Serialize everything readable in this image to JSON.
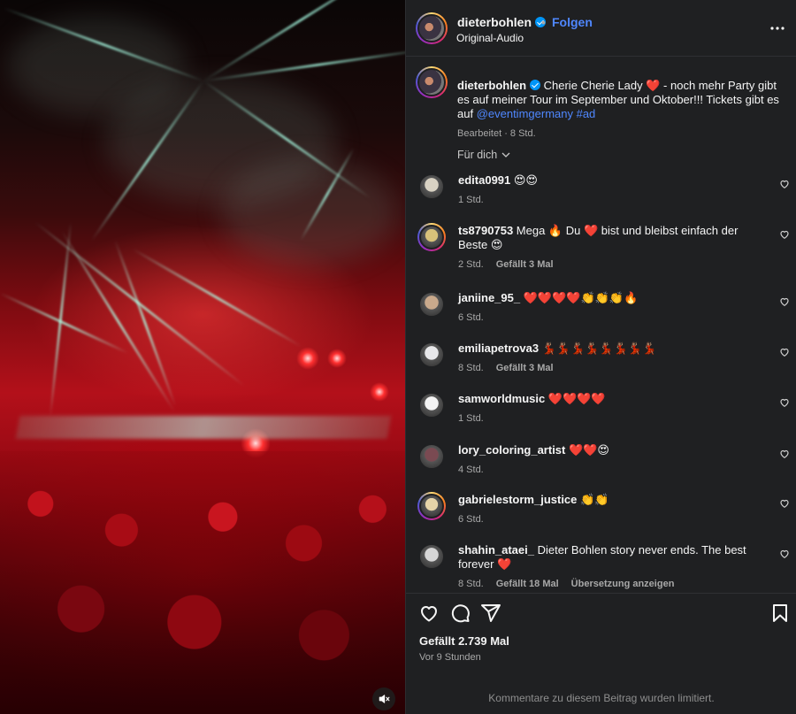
{
  "post": {
    "author": "dieterbohlen",
    "follow_label": "Folgen",
    "separator": "•",
    "audio": "Original-Audio",
    "caption_body": " Cherie Cherie Lady ❤️ - noch mehr Party gibt es auf meiner Tour im September und Oktober!!! Tickets gibt es auf ",
    "caption_mention": "@eventimgermany",
    "caption_hashtag": " #ad",
    "caption_meta": "Bearbeitet · 8 Std.",
    "filter_label": "Für dich"
  },
  "comments": [
    {
      "user": "edita0991",
      "text": " 😍😍",
      "time": "1 Std.",
      "likes": "",
      "extra": "",
      "avatar_color": "#d9d2c3",
      "ring": false
    },
    {
      "user": "ts8790753",
      "text": " Mega 🔥 Du ❤️ bist und bleibst einfach der Beste 😍",
      "time": "2 Std.",
      "likes": "Gefällt 3 Mal",
      "extra": "",
      "avatar_color": "#d8c27a",
      "ring": true
    },
    {
      "user": "janiine_95_",
      "text": " ❤️❤️❤️❤️👏👏👏🔥",
      "time": "6 Std.",
      "likes": "",
      "extra": "",
      "avatar_color": "#c9a98c",
      "ring": false
    },
    {
      "user": "emiliapetrova3",
      "text": " 💃🏽💃🏽💃🏽💃🏽💃🏽💃🏽💃🏽💃🏽",
      "time": "8 Std.",
      "likes": "Gefällt 3 Mal",
      "extra": "",
      "avatar_color": "#e8e8ea",
      "ring": false
    },
    {
      "user": "samworldmusic",
      "text": " ❤️❤️❤️❤️",
      "time": "1 Std.",
      "likes": "",
      "extra": "",
      "avatar_color": "#f4f4f4",
      "ring": false
    },
    {
      "user": "lory_coloring_artist",
      "text": " ❤️❤️😍",
      "time": "4 Std.",
      "likes": "",
      "extra": "",
      "avatar_color": "#7a4a52",
      "ring": false
    },
    {
      "user": "gabrielestorm_justice",
      "text": " 👏👏",
      "time": "6 Std.",
      "likes": "",
      "extra": "",
      "avatar_color": "#e6d4a8",
      "ring": true
    },
    {
      "user": "shahin_ataei_",
      "text": " Dieter Bohlen story never ends. The best forever ❤️",
      "time": "8 Std.",
      "likes": "Gefällt 18 Mal",
      "extra": "Übersetzung anzeigen",
      "avatar_color": "#d6d6d6",
      "ring": false
    }
  ],
  "footer": {
    "likes": "Gefällt 2.739 Mal",
    "ago": "Vor 9 Stunden",
    "limited": "Kommentare zu diesem Beitrag wurden limitiert."
  },
  "colors": {
    "panel_bg": "#1f2022",
    "link": "#4f87ff",
    "verified": "#0095f6",
    "muted": "#a8a8a8"
  },
  "icons": {
    "more": "more-horizontal-icon",
    "verified": "verified-badge-icon",
    "heart": "heart-icon",
    "comment": "comment-icon",
    "share": "share-icon",
    "save": "bookmark-icon",
    "mute": "speaker-muted-icon",
    "chevron": "chevron-down-icon"
  }
}
